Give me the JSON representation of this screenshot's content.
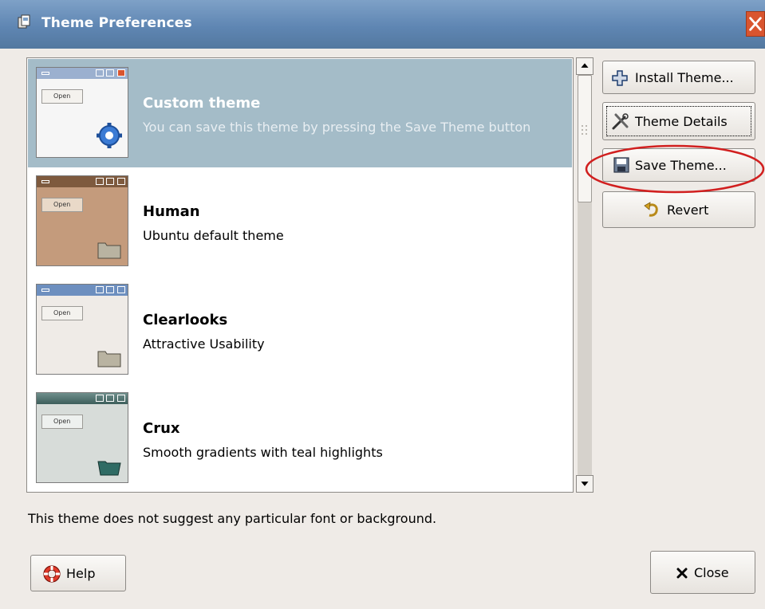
{
  "window": {
    "title": "Theme Preferences"
  },
  "themes": [
    {
      "name": "Custom theme",
      "description": "You can save this theme by pressing the Save Theme button",
      "selected": true
    },
    {
      "name": "Human",
      "description": "Ubuntu default theme",
      "selected": false
    },
    {
      "name": "Clearlooks",
      "description": "Attractive Usability",
      "selected": false
    },
    {
      "name": "Crux",
      "description": "Smooth gradients with teal highlights",
      "selected": false
    }
  ],
  "thumbnail": {
    "open_label": "Open"
  },
  "side_buttons": {
    "install": "Install Theme...",
    "details": "Theme Details",
    "save": "Save Theme...",
    "revert": "Revert"
  },
  "info": "This theme does not suggest any particular font or background.",
  "footer": {
    "help": "Help",
    "close": "Close"
  },
  "colors": {
    "titlebar": "#5f86b3",
    "selection": "#a4bcc8",
    "annotation": "#d11f1f"
  },
  "icons": {
    "title": "theme-app-icon",
    "install": "plus-icon",
    "details": "tools-icon",
    "save": "floppy-disk-icon",
    "revert": "undo-arrow-icon",
    "help": "lifebuoy-icon",
    "close": "x-icon"
  }
}
